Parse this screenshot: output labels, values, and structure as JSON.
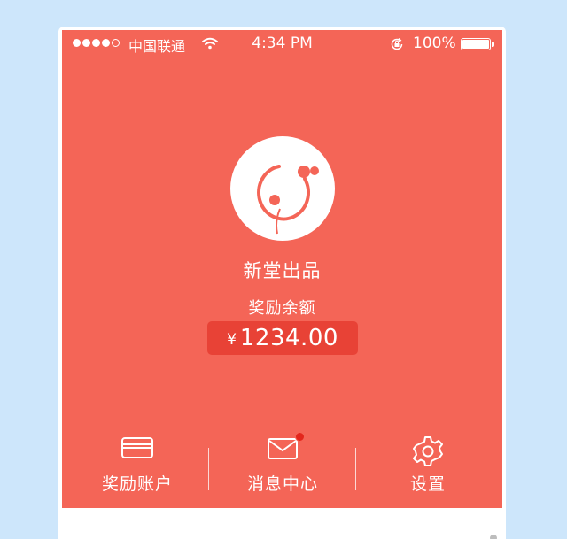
{
  "status_bar": {
    "carrier": "中国联通",
    "time": "4:34 PM",
    "battery": "100%",
    "signal_bars_filled": 4,
    "signal_bars_total": 5
  },
  "profile": {
    "brand_name": "新堂出品",
    "balance_label": "奖励余额",
    "currency_symbol": "¥",
    "balance_amount": "1234.00"
  },
  "menu": {
    "items": [
      {
        "label": "奖励账户",
        "icon": "card-icon"
      },
      {
        "label": "消息中心",
        "icon": "mail-icon",
        "has_notification": true
      },
      {
        "label": "设置",
        "icon": "gear-icon"
      }
    ]
  },
  "colors": {
    "background": "#cde6fb",
    "header": "#f46557",
    "balance_box": "#e84236",
    "badge": "#e3261c",
    "text_on_header": "#ffffff"
  }
}
